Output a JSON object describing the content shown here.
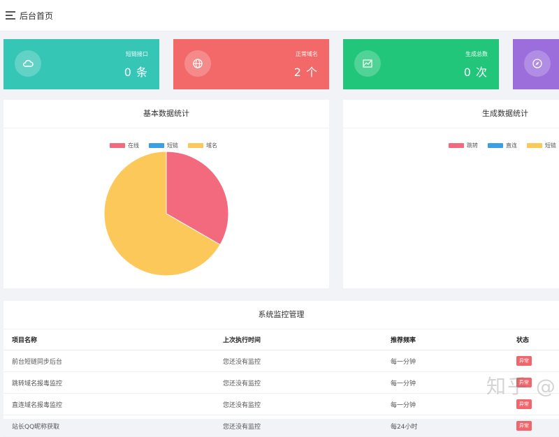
{
  "header": {
    "title": "后台首页",
    "menu_icon": "hamburger-menu-icon"
  },
  "cards": [
    {
      "label": "短链接口",
      "value": "0 条",
      "icon": "cloud-icon",
      "color": "#36c6b6"
    },
    {
      "label": "正常域名",
      "value": "2 个",
      "icon": "globe-icon",
      "color": "#f3696a"
    },
    {
      "label": "生成总数",
      "value": "0 次",
      "icon": "chart-icon",
      "color": "#21c67a"
    },
    {
      "label": "",
      "value": "",
      "icon": "compass-icon",
      "color": "#9b6edc"
    }
  ],
  "basic_stats": {
    "title": "基本数据统计",
    "legend": [
      {
        "label": "在线",
        "color": "#f3697e"
      },
      {
        "label": "短链",
        "color": "#3b9fe3"
      },
      {
        "label": "域名",
        "color": "#fdc85a"
      }
    ]
  },
  "gen_stats": {
    "title": "生成数据统计",
    "legend": [
      {
        "label": "跳转",
        "color": "#f3697e"
      },
      {
        "label": "直连",
        "color": "#3b9fe3"
      },
      {
        "label": "短链",
        "color": "#fdc85a"
      }
    ]
  },
  "chart_data": {
    "type": "pie",
    "categories": [
      "在线",
      "短链",
      "域名"
    ],
    "values": [
      1,
      0,
      2
    ],
    "colors": [
      "#f3697e",
      "#3b9fe3",
      "#fdc85a"
    ],
    "title": "基本数据统计",
    "legend_position": "top"
  },
  "monitor": {
    "title": "系统监控管理",
    "columns": [
      "项目名称",
      "上次执行时间",
      "推荐频率",
      "状态"
    ],
    "rows": [
      {
        "name": "前台短链同步后台",
        "last": "您还没有监控",
        "freq": "每一分钟",
        "status": "异常"
      },
      {
        "name": "跳转域名报毒监控",
        "last": "您还没有监控",
        "freq": "每一分钟",
        "status": "异常"
      },
      {
        "name": "直连域名报毒监控",
        "last": "您还没有监控",
        "freq": "每一分钟",
        "status": "异常"
      },
      {
        "name": "站长QQ昵称获取",
        "last": "您还没有监控",
        "freq": "每24小时",
        "status": "异常"
      }
    ]
  },
  "watermark": "知乎 @"
}
